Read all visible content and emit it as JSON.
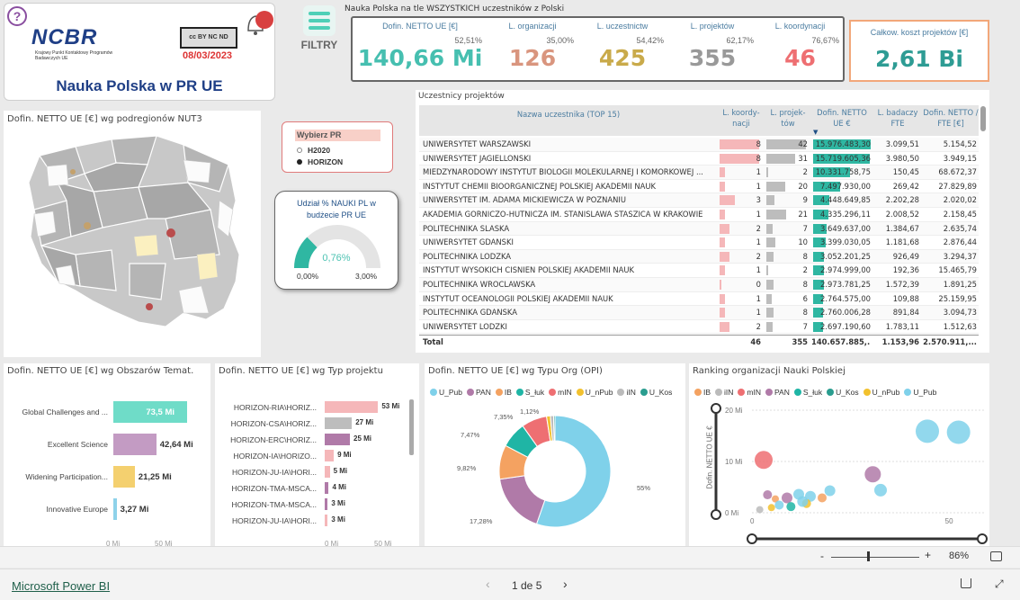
{
  "header": {
    "logo_text": "NCBR",
    "logo_sub": "Krajowy Punkt Kontaktowy Programów Badawczych UE",
    "cc_text": "cc BY NC ND",
    "date": "08/03/2023",
    "title": "Nauka Polska w PR UE",
    "help": "?",
    "filters_label": "FILTRY",
    "subtitle": "Nauka Polska na tle WSZYSTKICH uczestników z Polski"
  },
  "kpis": [
    {
      "label": "Dofin. NETTO UE [€]",
      "pct": "52,51%",
      "value": "140,66 Mi",
      "color": "#46bfb0"
    },
    {
      "label": "L. organizacji",
      "pct": "35,00%",
      "value": "126",
      "color": "#d9957e"
    },
    {
      "label": "L. uczestnictw",
      "pct": "54,42%",
      "value": "425",
      "color": "#c9aa4a"
    },
    {
      "label": "L. projektów",
      "pct": "62,17%",
      "value": "355",
      "color": "#999999"
    },
    {
      "label": "L. koordynacji",
      "pct": "76,67%",
      "value": "46",
      "color": "#ee6f72"
    }
  ],
  "kpi_total": {
    "label": "Całkow. koszt projektów [€]",
    "value": "2,61 Bi"
  },
  "map": {
    "title": "Dofin. NETTO UE [€] wg podregionów NUT3"
  },
  "pr_selector": {
    "title": "Wybierz PR",
    "options": [
      "H2020",
      "HORIZON"
    ],
    "selected": "HORIZON"
  },
  "gauge": {
    "title_1": "Udział % NAUKI PL w",
    "title_2": "budżecie PR UE",
    "value": "0,76%",
    "min": "0,00%",
    "max": "3,00%",
    "value_num": 0.76,
    "max_num": 3.0
  },
  "table": {
    "title": "Uczestnicy projektów",
    "headers": [
      "Nazwa uczestnika (TOP 15)",
      "L. koordy-nacji",
      "L. projek-tów",
      "Dofin. NETTO UE €",
      "L. badaczy FTE",
      "Dofin. NETTO / FTE [€]"
    ],
    "rows": [
      [
        "UNIWERSYTET WARSZAWSKI",
        "8",
        "42",
        "15.976.483,30",
        "3.099,51",
        "5.154,52",
        15976483
      ],
      [
        "UNIWERSYTET JAGIELLONSKI",
        "8",
        "31",
        "15.719.605,36",
        "3.980,50",
        "3.949,15",
        15719605
      ],
      [
        "MIEDZYNARODOWY INSTYTUT BIOLOGII MOLEKULARNEJ I KOMORKOWEJ ...",
        "1",
        "2",
        "10.331.758,75",
        "150,45",
        "68.672,37",
        10331758
      ],
      [
        "INSTYTUT CHEMII BIOORGANICZNEJ POLSKIEJ AKADEMII NAUK",
        "1",
        "20",
        "7.497.930,00",
        "269,42",
        "27.829,89",
        7497930
      ],
      [
        "UNIWERSYTET IM. ADAMA MICKIEWICZA W POZNANIU",
        "3",
        "9",
        "4.448.649,85",
        "2.202,28",
        "2.020,02",
        4448649
      ],
      [
        "AKADEMIA GORNICZO-HUTNICZA IM. STANISLAWA STASZICA W KRAKOWIE",
        "1",
        "21",
        "4.335.296,11",
        "2.008,52",
        "2.158,45",
        4335296
      ],
      [
        "POLITECHNIKA SLASKA",
        "2",
        "7",
        "3.649.637,00",
        "1.384,67",
        "2.635,74",
        3649637
      ],
      [
        "UNIWERSYTET GDANSKI",
        "1",
        "10",
        "3.399.030,05",
        "1.181,68",
        "2.876,44",
        3399030
      ],
      [
        "POLITECHNIKA LODZKA",
        "2",
        "8",
        "3.052.201,25",
        "926,49",
        "3.294,37",
        3052201
      ],
      [
        "INSTYTUT WYSOKICH CISNIEN POLSKIEJ AKADEMII NAUK",
        "1",
        "2",
        "2.974.999,00",
        "192,36",
        "15.465,79",
        2974999
      ],
      [
        "POLITECHNIKA WROCLAWSKA",
        "0",
        "8",
        "2.973.781,25",
        "1.572,39",
        "1.891,25",
        2973781
      ],
      [
        "INSTYTUT OCEANOLOGII POLSKIEJ AKADEMII NAUK",
        "1",
        "6",
        "2.764.575,00",
        "109,88",
        "25.159,95",
        2764575
      ],
      [
        "POLITECHNIKA GDANSKA",
        "1",
        "8",
        "2.760.006,28",
        "891,84",
        "3.094,73",
        2760006
      ],
      [
        "UNIWERSYTET LODZKI",
        "2",
        "7",
        "2.697.190,60",
        "1.783,11",
        "1.512,63",
        2697190
      ]
    ],
    "total": [
      "Total",
      "46",
      "355",
      "140.657.885,...",
      "1.153,96",
      "2.570.911,..."
    ]
  },
  "chart_data": [
    {
      "type": "bar",
      "title": "Dofin. NETTO UE [€] wg Obszarów Temat.",
      "categories": [
        "Global Challenges and ...",
        "Excellent Science",
        "Widening Participation...",
        "Innovative Europe"
      ],
      "values": [
        73.5,
        42.64,
        21.25,
        3.27
      ],
      "labels": [
        "73,5 Mi",
        "42,64 Mi",
        "21,25 Mi",
        "3,27 Mi"
      ],
      "colors": [
        "#6fdcc8",
        "#c39bc3",
        "#f4d06f",
        "#8ed2ea"
      ],
      "ticks": [
        "0 Mi",
        "50 Mi"
      ],
      "xlim": [
        0,
        50
      ]
    },
    {
      "type": "bar",
      "title": "Dofin. NETTO UE [€] wg Typ projektu",
      "categories": [
        "HORIZON-RIA\\HORIZ...",
        "HORIZON-CSA\\HORIZ...",
        "HORIZON-ERC\\HORIZ...",
        "HORIZON-IA\\HORIZO...",
        "HORIZON-JU-IA\\HORI...",
        "HORIZON-TMA-MSCA...",
        "HORIZON-TMA-MSCA...",
        "HORIZON-JU-IA\\HORI..."
      ],
      "values": [
        53,
        27,
        25,
        9,
        5,
        4,
        3,
        3
      ],
      "labels": [
        "53 Mi",
        "27 Mi",
        "25 Mi",
        "9 Mi",
        "5 Mi",
        "4 Mi",
        "3 Mi",
        "3 Mi"
      ],
      "colors": [
        "#f5b7b9",
        "#bdbdbd",
        "#b07aa8",
        "#f5b7b9",
        "#f5b7b9",
        "#b07aa8",
        "#b07aa8",
        "#f5b7b9"
      ],
      "ticks": [
        "0 Mi",
        "50 Mi"
      ],
      "xlim": [
        0,
        50
      ]
    },
    {
      "type": "pie",
      "title": "Dofin. NETTO UE [€] wg Typu Org (OPI)",
      "legend": [
        [
          "U_Pub",
          "#7fd1ea"
        ],
        [
          "PAN",
          "#b07aa8"
        ],
        [
          "IB",
          "#f4a261"
        ],
        [
          "S_łuk",
          "#1fb5a5"
        ],
        [
          "mIN",
          "#ee6f72"
        ],
        [
          "U_nPub",
          "#f2c12e"
        ],
        [
          "iIN",
          "#bbbbbb"
        ],
        [
          "U_Kos",
          "#2a9d8f"
        ]
      ],
      "values": [
        55,
        17.28,
        9.82,
        7.47,
        7.35,
        1.12,
        0.9,
        0.4
      ],
      "colors": [
        "#7fd1ea",
        "#b07aa8",
        "#f4a261",
        "#1fb5a5",
        "#ee6f72",
        "#f2c12e",
        "#bbbbbb",
        "#2a9d8f"
      ],
      "labels": [
        "55%",
        "17,28%",
        "9,82%",
        "7,47%",
        "7,35%",
        "1,12%"
      ]
    },
    {
      "type": "scatter",
      "title": "Ranking organizacji Nauki Polskiej",
      "legend": [
        [
          "IB",
          "#f4a261"
        ],
        [
          "iIN",
          "#bbbbbb"
        ],
        [
          "mIN",
          "#ee6f72"
        ],
        [
          "PAN",
          "#b07aa8"
        ],
        [
          "S_łuk",
          "#1fb5a5"
        ],
        [
          "U_Kos",
          "#2a9d8f"
        ],
        [
          "U_nPub",
          "#f2c12e"
        ],
        [
          "U_Pub",
          "#7fd1ea"
        ]
      ],
      "ylabel": "Dofin. NETTO UE €",
      "yticks": [
        "20 Mi",
        "10 Mi",
        "0 Mi"
      ],
      "xticks": [
        "0",
        "50"
      ],
      "xlim": [
        0,
        60
      ],
      "ylim": [
        0,
        20
      ],
      "points": [
        {
          "x": 45,
          "y": 15.9,
          "r": 13,
          "c": "#7fd1ea"
        },
        {
          "x": 53,
          "y": 15.7,
          "r": 13,
          "c": "#7fd1ea"
        },
        {
          "x": 3,
          "y": 10.3,
          "r": 10,
          "c": "#ee6f72"
        },
        {
          "x": 31,
          "y": 7.5,
          "r": 9,
          "c": "#b07aa8"
        },
        {
          "x": 33,
          "y": 4.4,
          "r": 7,
          "c": "#7fd1ea"
        },
        {
          "x": 20,
          "y": 4.3,
          "r": 6,
          "c": "#7fd1ea"
        },
        {
          "x": 12,
          "y": 3.6,
          "r": 6,
          "c": "#7fd1ea"
        },
        {
          "x": 15,
          "y": 3.2,
          "r": 6,
          "c": "#7fd1ea"
        },
        {
          "x": 4,
          "y": 3.5,
          "r": 5,
          "c": "#b07aa8"
        },
        {
          "x": 9,
          "y": 2.9,
          "r": 6,
          "c": "#b07aa8"
        },
        {
          "x": 6,
          "y": 2.7,
          "r": 4,
          "c": "#f4a261"
        },
        {
          "x": 18,
          "y": 2.9,
          "r": 5,
          "c": "#f4a261"
        },
        {
          "x": 14,
          "y": 1.8,
          "r": 5,
          "c": "#f2c12e"
        },
        {
          "x": 7,
          "y": 1.5,
          "r": 5,
          "c": "#7fd1ea"
        },
        {
          "x": 10,
          "y": 1.2,
          "r": 5,
          "c": "#1fb5a5"
        },
        {
          "x": 5,
          "y": 1.0,
          "r": 4,
          "c": "#f2c12e"
        },
        {
          "x": 13,
          "y": 2.2,
          "r": 6,
          "c": "#7fd1ea"
        },
        {
          "x": 2,
          "y": 0.6,
          "r": 4,
          "c": "#bbbbbb"
        }
      ]
    }
  ],
  "footer": {
    "brand": "Microsoft Power BI",
    "page": "1 de 5",
    "zoom": "86%"
  }
}
